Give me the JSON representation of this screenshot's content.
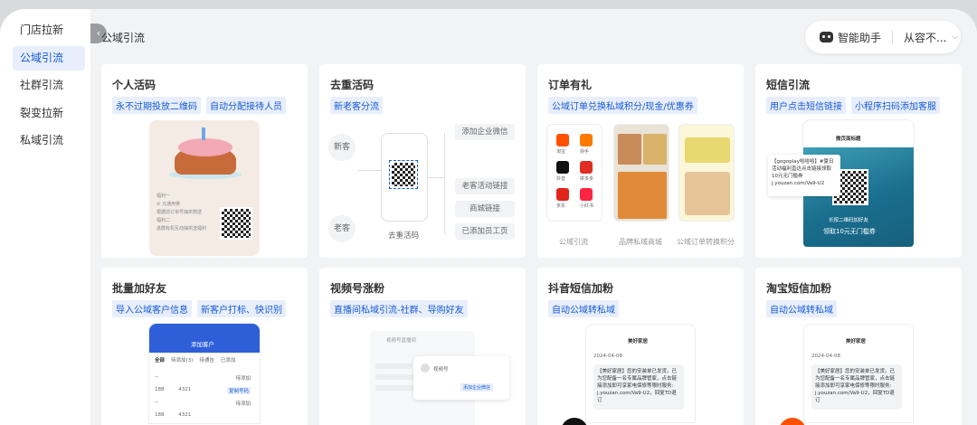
{
  "sidebar": {
    "items": [
      {
        "label": "门店拉新",
        "active": false
      },
      {
        "label": "公域引流",
        "active": true
      },
      {
        "label": "社群引流",
        "active": false
      },
      {
        "label": "裂变拉新",
        "active": false
      },
      {
        "label": "私域引流",
        "active": false
      }
    ]
  },
  "header": {
    "back_icon": "chevron-left-icon",
    "title": "公域引流",
    "assistant_label": "智能助手",
    "account_label": "从容不...",
    "account_chevron": "chevron-down-icon"
  },
  "colors": {
    "accent": "#155bd4",
    "tag_bg": "#e8eefb",
    "page_bg": "#f2f3f5"
  },
  "cards": [
    {
      "title": "个人活码",
      "tags": [
        "永不过期投放二维码",
        "自动分配接待人员"
      ],
      "preview": {
        "lines": [
          "福利一",
          "⑤ 元通用券",
          "根据前订单号抽奖赠送",
          "福利二",
          "进群有机互动抽奖送福利"
        ]
      }
    },
    {
      "title": "去重活码",
      "tags": [
        "新老客分流"
      ],
      "preview": {
        "new_customer": "新客",
        "old_customer": "老客",
        "qr_caption": "去重活码",
        "targets": [
          "添加企业微信",
          "老客活动链接",
          "商城链接",
          "已添加员工页"
        ]
      }
    },
    {
      "title": "订单有礼",
      "tags": [
        "公域订单兑换私域积分/现金/优惠券"
      ],
      "preview": {
        "apps": [
          "淘宝",
          "快手",
          "抖音",
          "拼多多",
          "京东",
          "小红书"
        ],
        "captions": [
          "公域引流",
          "品牌私域商城",
          "公域订单转换积分"
        ]
      }
    },
    {
      "title": "短信引流",
      "tags": [
        "用户点击短信链接",
        "小程序扫码添加客服"
      ],
      "preview": {
        "page_title": "微页面标题",
        "sms_text": "【gogoplay哈哈哈】#夏日活动福利直达点击链接领取 10元无门槛券 j.youzan.com/Va9-U2",
        "banner_line1": "长按二维码加好友",
        "banner_line2": "领取10元无门槛券"
      }
    },
    {
      "title": "批量加好友",
      "tags": [
        "导入公域客户信息",
        "新客户打标、快识别"
      ],
      "preview": {
        "header": "添加客户",
        "tabs": [
          "全部",
          "待添加(3)",
          "待通告",
          "已添加"
        ],
        "rows": [
          {
            "name": "--",
            "status": "待添加",
            "phone": "188",
            "code": "4321",
            "action": "复制号码"
          },
          {
            "name": "--",
            "status": "待添加",
            "phone": "188",
            "code": "4321",
            "action": ""
          }
        ]
      }
    },
    {
      "title": "视频号涨粉",
      "tags": [
        "直播间私域引流-社群、导购好友"
      ],
      "preview": {
        "live_label": "视频号直播间",
        "account_label": "视频号",
        "button_label": "添加企业微信"
      }
    },
    {
      "title": "抖音短信加粉",
      "tags": [
        "自动公域转私域"
      ],
      "preview": {
        "shop": "美好家居",
        "date": "2024-04-08",
        "message": "【美好家居】您的安装单已发货。已为您配备一名专属品牌管家，点击链接添加即可享家电保修等限时服务: j.youzan.com/Va9-U2，回复TD退订"
      }
    },
    {
      "title": "淘宝短信加粉",
      "tags": [
        "自动公域转私域"
      ],
      "preview": {
        "shop": "美好家居",
        "date": "2024-04-08",
        "message": "【美好家居】您的安装单已发货。已为您配备一名专属品牌管家，点击链接添加即可享家电保修等限时服务: j.youzan.com/Va9-U2，回复TD退订"
      }
    }
  ]
}
